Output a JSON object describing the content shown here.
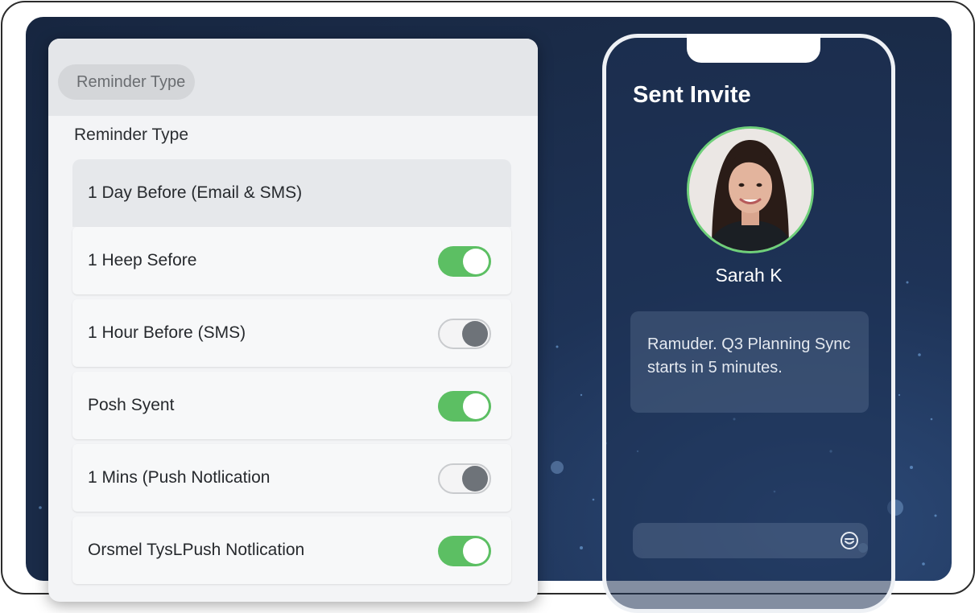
{
  "settings": {
    "chip_label": "Reminder Type",
    "section_title": "Reminder Type",
    "rows": [
      {
        "label": "1 Day Before (Email & SMS)",
        "toggle": null,
        "selected": true
      },
      {
        "label": "1 Heep Sefore",
        "toggle": "on"
      },
      {
        "label": "1 Hour Before (SMS)",
        "toggle": "off"
      },
      {
        "label": "Posh Syent",
        "toggle": "on"
      },
      {
        "label": "1 Mins (Push Notlication",
        "toggle": "off"
      },
      {
        "label": "Orsmel TysLPush Notlication",
        "toggle": "on"
      }
    ]
  },
  "phone": {
    "title": "Sent Invite",
    "contact_name": "Sarah K",
    "message": "Ramuder. Q3 Planning Sync starts in 5 minutes.",
    "input_placeholder": ""
  },
  "colors": {
    "toggle_on": "#5cbf63",
    "avatar_ring": "#6fd07a",
    "background": "#1e3357"
  },
  "icons": {
    "input_action": "emoji-icon"
  }
}
